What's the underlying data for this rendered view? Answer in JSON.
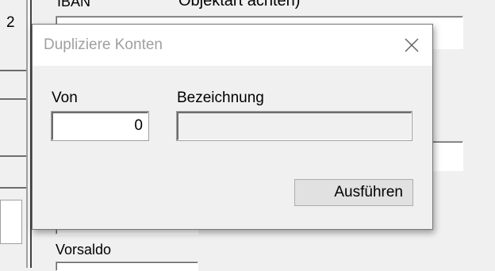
{
  "background": {
    "top_title": "Objektart achten)",
    "iban_label": "IBAN",
    "left_number": "2",
    "vorsaldo_label": "Vorsaldo"
  },
  "dialog": {
    "title": "Dupliziere Konten",
    "close_icon": "close-icon",
    "von_label": "Von",
    "von_value": "0",
    "bezeichnung_label": "Bezeichnung",
    "bezeichnung_value": "",
    "execute_button_label": "Ausführen"
  }
}
